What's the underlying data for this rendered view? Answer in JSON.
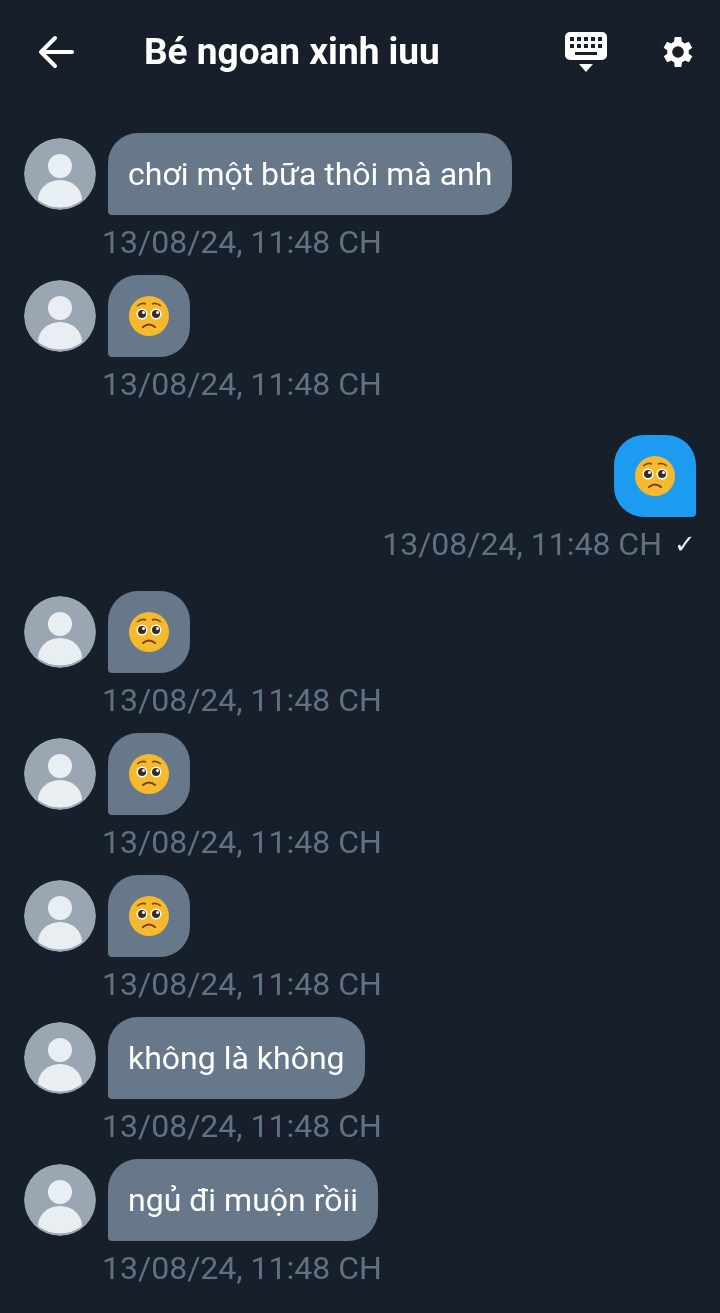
{
  "header": {
    "title": "Bé ngoan xinh iuu"
  },
  "messages": [
    {
      "kind": "text",
      "outgoing": false,
      "text": "chơi một bữa thôi mà anh",
      "time": "13/08/24, 11:48 CH"
    },
    {
      "kind": "emoji",
      "outgoing": false,
      "time": "13/08/24, 11:48 CH"
    },
    {
      "kind": "emoji",
      "outgoing": true,
      "time": "13/08/24, 11:48 CH",
      "status": "✓"
    },
    {
      "kind": "emoji",
      "outgoing": false,
      "time": "13/08/24, 11:48 CH"
    },
    {
      "kind": "emoji",
      "outgoing": false,
      "time": "13/08/24, 11:48 CH"
    },
    {
      "kind": "emoji",
      "outgoing": false,
      "time": "13/08/24, 11:48 CH"
    },
    {
      "kind": "text",
      "outgoing": false,
      "text": "không là không",
      "time": "13/08/24, 11:48 CH"
    },
    {
      "kind": "text",
      "outgoing": false,
      "text": "ngủ đi muộn rồii",
      "time": "13/08/24, 11:48 CH"
    }
  ]
}
